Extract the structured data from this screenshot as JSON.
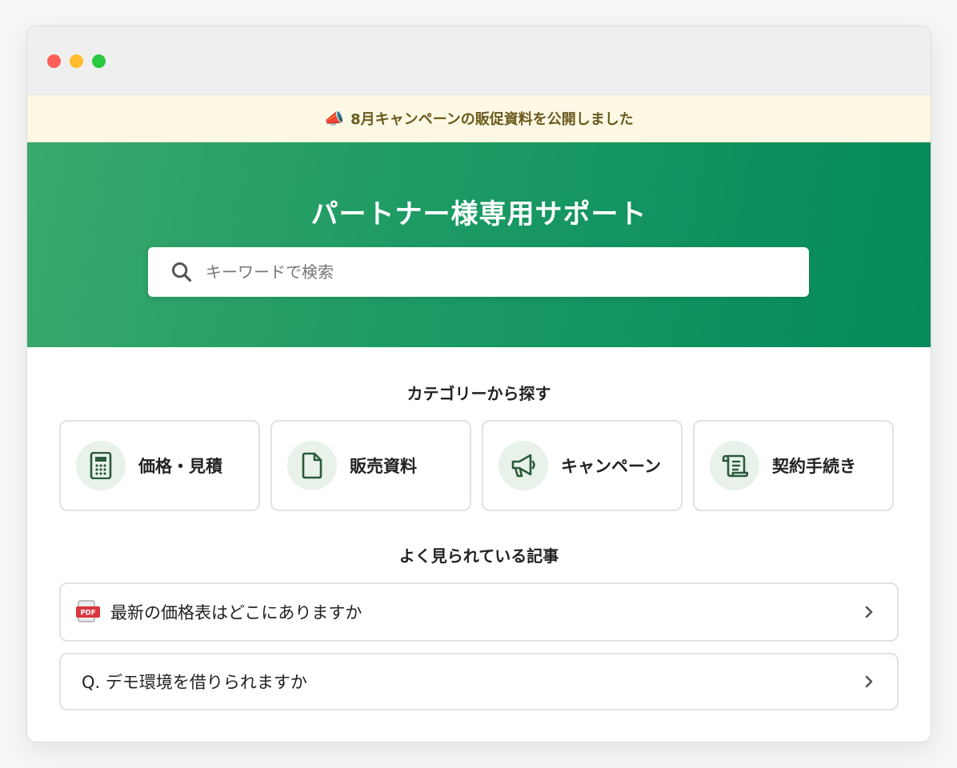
{
  "announcement": {
    "icon": "megaphone-icon",
    "text": "8月キャンペーンの販促資料を公開しました"
  },
  "hero": {
    "title": "パートナー様専用サポート",
    "search": {
      "placeholder": "キーワードで検索",
      "value": ""
    }
  },
  "categories": {
    "title": "カテゴリーから探す",
    "items": [
      {
        "label": "価格・見積",
        "icon": "calculator-icon"
      },
      {
        "label": "販売資料",
        "icon": "document-icon"
      },
      {
        "label": "キャンペーン",
        "icon": "megaphone-icon"
      },
      {
        "label": "契約手続き",
        "icon": "scroll-icon"
      }
    ]
  },
  "popular": {
    "title": "よく見られている記事",
    "items": [
      {
        "text": "最新の価格表はどこにありますか",
        "icon": "pdf-icon",
        "badge": "PDF"
      },
      {
        "text": "Q. デモ環境を借りられますか"
      }
    ]
  },
  "colors": {
    "hero_start": "#3aa86b",
    "hero_end": "#058a5a",
    "icon_dark": "#2a5a3a",
    "icon_bg": "#e8f2ea",
    "announce_bg": "#fdf8e4"
  }
}
